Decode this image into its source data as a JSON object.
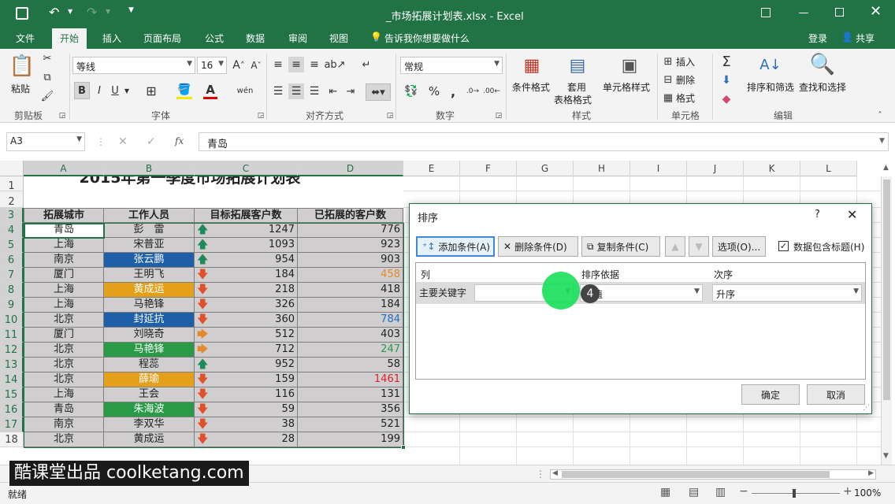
{
  "window": {
    "title": "_市场拓展计划表.xlsx - Excel",
    "sign_in": "登录",
    "share": "共享"
  },
  "tabs": [
    {
      "label": "文件"
    },
    {
      "label": "开始"
    },
    {
      "label": "插入"
    },
    {
      "label": "页面布局"
    },
    {
      "label": "公式"
    },
    {
      "label": "数据"
    },
    {
      "label": "审阅"
    },
    {
      "label": "视图"
    }
  ],
  "tell_me": "告诉我你想要做什么",
  "ribbon": {
    "groups": {
      "clipboard": "剪贴板",
      "font": "字体",
      "align": "对齐方式",
      "number": "数字",
      "styles": "样式",
      "cells": "单元格",
      "edit": "编辑"
    },
    "paste": "粘贴",
    "font_name": "等线",
    "font_size": "16",
    "number_format": "常规",
    "cond_format": "条件格式",
    "table_format_1": "套用",
    "table_format_2": "表格格式",
    "cell_style": "单元格样式",
    "insert": "插入",
    "delete": "删除",
    "format": "格式",
    "sort_filter": "排序和筛选",
    "find_select": "查找和选择",
    "bold": "B",
    "italic": "I",
    "underline": "U",
    "percent": "%",
    "comma": ","
  },
  "formula_bar": {
    "name_box": "A3",
    "fx": "fx",
    "content": "青岛"
  },
  "sheet": {
    "columns": [
      "A",
      "B",
      "C",
      "D",
      "E",
      "F",
      "G",
      "H",
      "I",
      "J",
      "K",
      "L"
    ],
    "rows": [
      "1",
      "2",
      "3",
      "4",
      "5",
      "6",
      "7",
      "8",
      "9",
      "10",
      "11",
      "12",
      "13",
      "14",
      "15",
      "16",
      "17",
      "18"
    ],
    "title": "2015年第一季度市场拓展计划表",
    "headers": [
      "拓展城市",
      "工作人员",
      "目标拓展客户数",
      "已拓展的客户数"
    ],
    "data": [
      {
        "city": "青岛",
        "person": "彭　雷",
        "target": "1247",
        "done": "776",
        "arrow": "up"
      },
      {
        "city": "上海",
        "person": "宋普亚",
        "target": "1093",
        "done": "923",
        "arrow": "up"
      },
      {
        "city": "南京",
        "person": "张云鹏",
        "target": "954",
        "done": "903",
        "arrow": "up",
        "pfill": "#1f5fa8"
      },
      {
        "city": "厦门",
        "person": "王明飞",
        "target": "184",
        "done": "458",
        "arrow": "down",
        "dcolor": "#e48a2c"
      },
      {
        "city": "上海",
        "person": "黄成运",
        "target": "218",
        "done": "418",
        "arrow": "down",
        "pfill": "#e4a01a"
      },
      {
        "city": "上海",
        "person": "马艳锋",
        "target": "326",
        "done": "184",
        "arrow": "down"
      },
      {
        "city": "北京",
        "person": "封延抗",
        "target": "360",
        "done": "784",
        "arrow": "down",
        "pfill": "#1f5fa8",
        "dcolor": "#1f6fc5"
      },
      {
        "city": "厦门",
        "person": "刘晓奇",
        "target": "512",
        "done": "403",
        "arrow": "right"
      },
      {
        "city": "北京",
        "person": "马艳锋",
        "target": "712",
        "done": "247",
        "arrow": "right",
        "pfill": "#2a9a47",
        "dcolor": "#2a9a47"
      },
      {
        "city": "北京",
        "person": "程蕊",
        "target": "952",
        "done": "58",
        "arrow": "up"
      },
      {
        "city": "北京",
        "person": "薛瑜",
        "target": "159",
        "done": "1461",
        "arrow": "down",
        "pfill": "#e4a01a",
        "dcolor": "#e0202a"
      },
      {
        "city": "上海",
        "person": "王会",
        "target": "116",
        "done": "131",
        "arrow": "down"
      },
      {
        "city": "青岛",
        "person": "朱海波",
        "target": "59",
        "done": "356",
        "arrow": "down",
        "pfill": "#2a9a47"
      },
      {
        "city": "南京",
        "person": "李双华",
        "target": "38",
        "done": "521",
        "arrow": "down"
      },
      {
        "city": "北京",
        "person": "黄成运",
        "target": "28",
        "done": "199",
        "arrow": "down"
      }
    ]
  },
  "dialog": {
    "title": "排序",
    "help": "?",
    "add": "添加条件(A)",
    "delete": "删除条件(D)",
    "copy": "复制条件(C)",
    "options": "选项(O)...",
    "header_check": "数据包含标题(H)",
    "col_header": "列",
    "sortby_header": "排序依据",
    "order_header": "次序",
    "primary_key": "主要关键字",
    "sortby_value": "数值",
    "order_value": "升序",
    "ok": "确定",
    "cancel": "取消",
    "step_badge": "4"
  },
  "status": {
    "ready": "就绪",
    "zoom": "100%"
  },
  "watermark": "酷课堂出品 coolketang.com"
}
